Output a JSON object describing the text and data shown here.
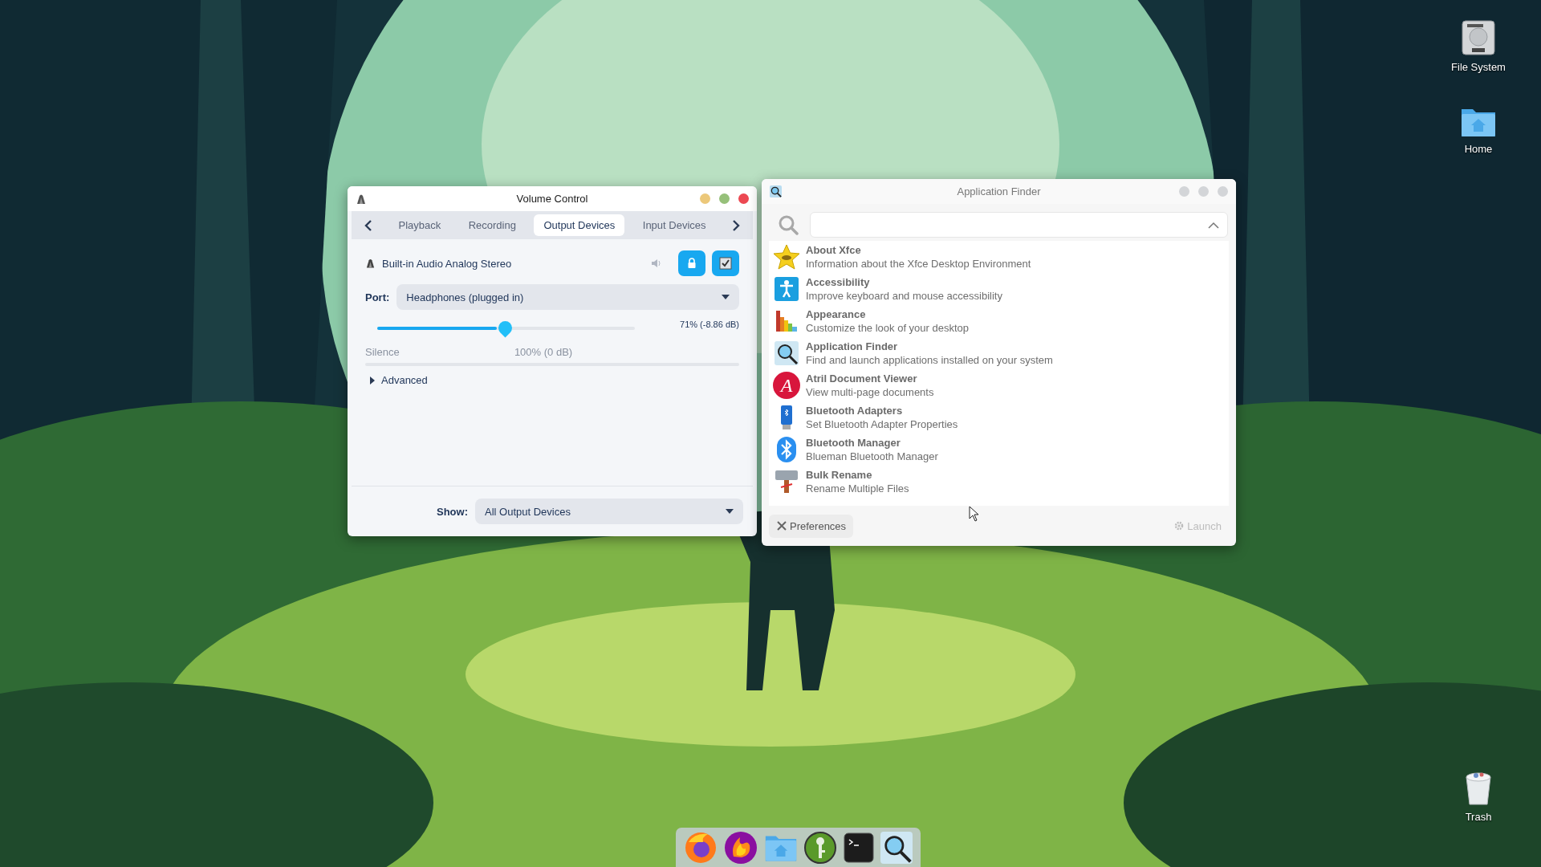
{
  "desktop": {
    "icons": [
      {
        "label": "File System",
        "kind": "drive"
      },
      {
        "label": "Home",
        "kind": "home"
      },
      {
        "label": "Trash",
        "kind": "trash"
      }
    ]
  },
  "volume_control": {
    "title": "Volume Control",
    "focused": true,
    "tabs": [
      {
        "label": "Playback",
        "selected": false
      },
      {
        "label": "Recording",
        "selected": false
      },
      {
        "label": "Output Devices",
        "selected": true
      },
      {
        "label": "Input Devices",
        "selected": false
      }
    ],
    "device": {
      "name": "Built-in Audio Analog Stereo",
      "lock_on": true,
      "default_on": true
    },
    "port": {
      "label": "Port:",
      "value": "Headphones (plugged in)"
    },
    "volume": {
      "level": 0.465,
      "reading": "71% (-8.86 dB)",
      "low_mark": "Silence",
      "norm_mark": "100% (0 dB)"
    },
    "advanced": {
      "label": "Advanced",
      "expanded": false
    },
    "show": {
      "label": "Show:",
      "value": "All Output Devices"
    }
  },
  "app_finder": {
    "title": "Application Finder",
    "focused": false,
    "search": {
      "expanded": true
    },
    "items": [
      {
        "kind": "star",
        "name": "About Xfce",
        "description": "Information about the Xfce Desktop Environment"
      },
      {
        "kind": "accessibility",
        "name": "Accessibility",
        "description": "Improve keyboard and mouse accessibility"
      },
      {
        "kind": "palette",
        "name": "Appearance",
        "description": "Customize the look of your desktop"
      },
      {
        "kind": "finder",
        "name": "Application Finder",
        "description": "Find and launch applications installed on your system"
      },
      {
        "kind": "atril",
        "name": "Atril Document Viewer",
        "description": "View multi-page documents",
        "glyph": "A"
      },
      {
        "kind": "adapter",
        "name": "Bluetooth Adapters",
        "description": "Set Bluetooth Adapter Properties"
      },
      {
        "kind": "bluetooth",
        "name": "Bluetooth Manager",
        "description": "Blueman Bluetooth Manager"
      },
      {
        "kind": "rename",
        "name": "Bulk Rename",
        "description": "Rename Multiple Files"
      }
    ],
    "preferences": {
      "label": "Preferences"
    },
    "launch": {
      "label": "Launch",
      "disabled": true
    }
  },
  "dock": {
    "apps": [
      {
        "kind": "firefox"
      },
      {
        "kind": "flame"
      },
      {
        "kind": "folder"
      },
      {
        "kind": "key"
      },
      {
        "kind": "terminal"
      },
      {
        "kind": "finder"
      }
    ]
  }
}
